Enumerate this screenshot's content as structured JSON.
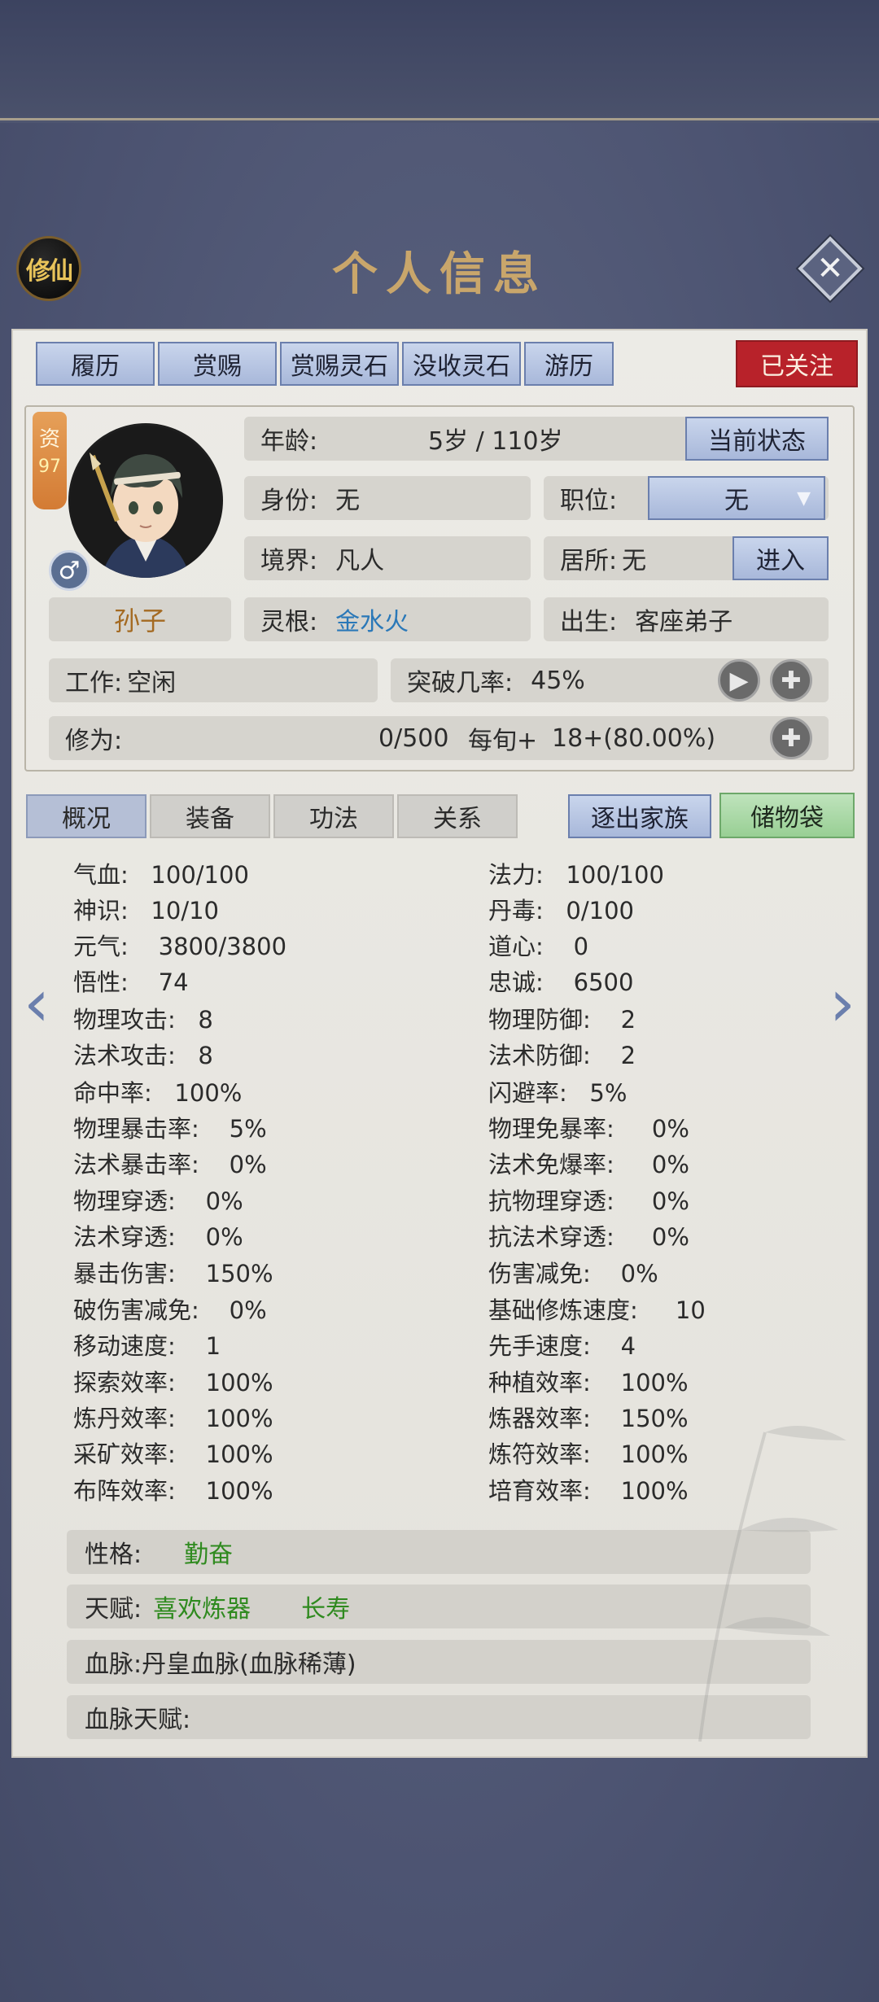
{
  "header": {
    "badge": "修仙",
    "title": "个人信息",
    "close": "✕"
  },
  "top_buttons": [
    "履历",
    "赏赐",
    "赏赐灵石",
    "没收灵石",
    "游历"
  ],
  "follow_button": "已关注",
  "character": {
    "zi_label": "资",
    "zi_value": "97",
    "gender_symbol": "♂",
    "name": "孙子",
    "age_label": "年龄:",
    "age_value": "5岁 / 110岁",
    "status_button": "当前状态",
    "identity_label": "身份:",
    "identity_value": "无",
    "position_label": "职位:",
    "position_value": "无",
    "realm_label": "境界:",
    "realm_value": "凡人",
    "residence_label": "居所:",
    "residence_value": "无",
    "enter_button": "进入",
    "root_label": "灵根:",
    "root_value": "金水火",
    "birth_label": "出生:",
    "birth_value": "客座弟子",
    "work_label": "工作:",
    "work_value": "空闲",
    "breakthrough_label": "突破几率:",
    "breakthrough_value": "45%",
    "cultivation_label": "修为:",
    "cultivation_value": "0/500",
    "cultivation_rate_label": "每旬+",
    "cultivation_rate_value": "18+(80.00%)"
  },
  "tabs": [
    "概况",
    "装备",
    "功法",
    "关系"
  ],
  "expel_button": "逐出家族",
  "storage_button": "储物袋",
  "stats": [
    [
      "气血:   100/100",
      "法力:   100/100"
    ],
    [
      "神识:   10/10",
      "丹毒:   0/100"
    ],
    [
      "元气:    3800/3800",
      "道心:    0"
    ],
    [
      "悟性:    74",
      "忠诚:    6500"
    ],
    [
      "物理攻击:   8",
      "物理防御:    2"
    ],
    [
      "法术攻击:   8",
      "法术防御:    2"
    ],
    [
      "命中率:   100%",
      "闪避率:   5%"
    ],
    [
      "物理暴击率:    5%",
      "物理免暴率:     0%"
    ],
    [
      "法术暴击率:    0%",
      "法术免爆率:     0%"
    ],
    [
      "物理穿透:    0%",
      "抗物理穿透:     0%"
    ],
    [
      "法术穿透:    0%",
      "抗法术穿透:     0%"
    ],
    [
      "暴击伤害:    150%",
      "伤害减免:    0%"
    ],
    [
      "破伤害减免:    0%",
      "基础修炼速度:     10"
    ],
    [
      "移动速度:    1",
      "先手速度:    4"
    ],
    [
      "探索效率:    100%",
      "种植效率:    100%"
    ],
    [
      "炼丹效率:    100%",
      "炼器效率:    150%"
    ],
    [
      "采矿效率:    100%",
      "炼符效率:    100%"
    ],
    [
      "布阵效率:    100%",
      "培育效率:    100%"
    ]
  ],
  "traits": {
    "personality_label": "性格:",
    "personality_value": "勤奋",
    "talent_label": "天赋:",
    "talent_values": [
      "喜欢炼器",
      "长寿"
    ],
    "bloodline_label": "血脉:",
    "bloodline_value": "丹皇血脉(血脉稀薄)",
    "bloodline_talent_label": "血脉天赋:"
  },
  "colors": {
    "accent_blue": "#a8b8da",
    "follow_red": "#b8222a",
    "storage_green": "#98cf94",
    "name_gold": "#a46a22",
    "trait_green": "#2f8a1f",
    "root_blue": "#2a78b8"
  }
}
